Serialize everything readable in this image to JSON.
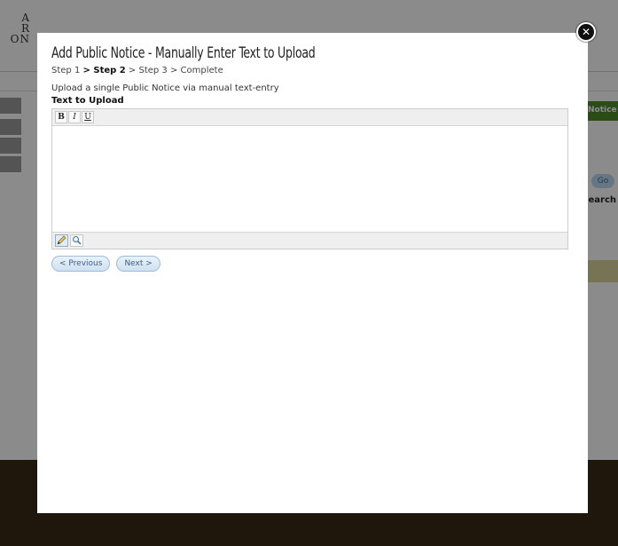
{
  "background": {
    "logo_lines": [
      "A",
      "R",
      "ON"
    ],
    "tab_label": "Notice",
    "go_label": "Go",
    "search_label": "earch"
  },
  "modal": {
    "title": "Add Public Notice - Manually Enter Text to Upload",
    "steps": {
      "step1": "Step 1",
      "step2": "> Step 2",
      "step3": "> Step 3",
      "complete": "> Complete"
    },
    "intro": "Upload a single Public Notice via manual text-entry",
    "field_label": "Text to Upload",
    "editor": {
      "bold": "B",
      "italic": "I",
      "underline": "U",
      "value": ""
    },
    "buttons": {
      "previous": "< Previous",
      "next": "Next >"
    }
  },
  "icons": {
    "close": "close-icon",
    "design_mode": "pencil-icon",
    "preview_mode": "magnifier-icon"
  },
  "colors": {
    "overlay": "#2f2f2f",
    "tab_green": "#4f8a2a",
    "pill_text": "#3b5f85"
  }
}
